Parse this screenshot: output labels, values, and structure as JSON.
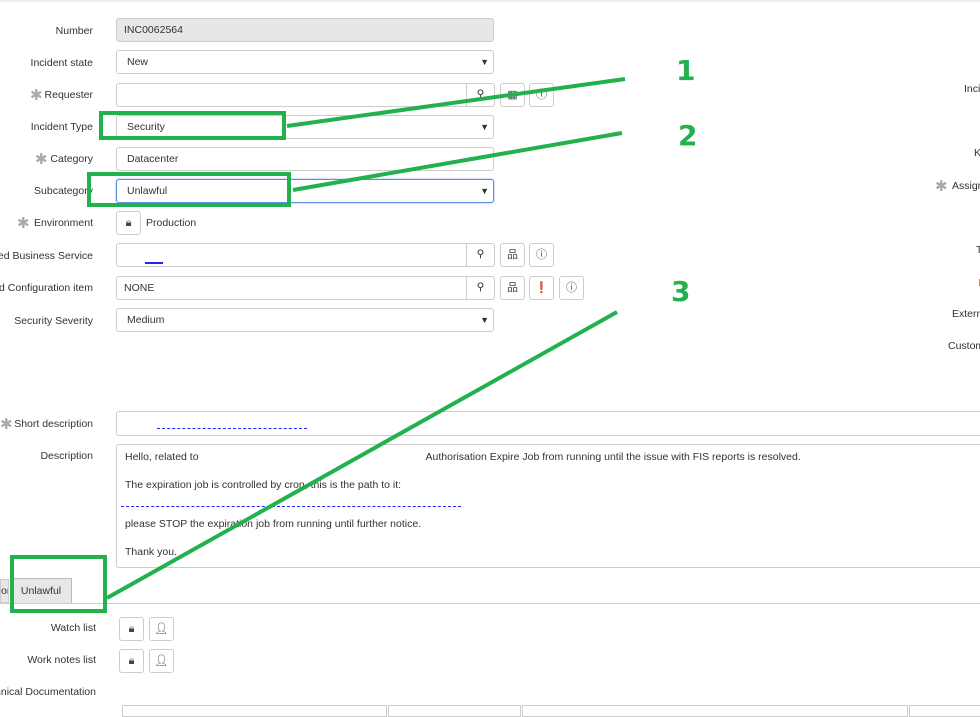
{
  "form": {
    "number": {
      "label": "Number",
      "value": "INC0062564"
    },
    "incident_state": {
      "label": "Incident state",
      "value": "New"
    },
    "requester": {
      "label": "Requester",
      "value": ""
    },
    "incident_type": {
      "label": "Incident Type",
      "value": "Security"
    },
    "category": {
      "label": "Category",
      "value": "Datacenter"
    },
    "subcategory": {
      "label": "Subcategory",
      "value": "Unlawful"
    },
    "environment": {
      "label": "Environment",
      "value": "Production"
    },
    "business_service": {
      "label": "cted Business Service",
      "value": ""
    },
    "config_item": {
      "label": "ed Configuration item",
      "value": "NONE"
    },
    "security_severity": {
      "label": "Security Severity",
      "value": "Medium"
    },
    "short_description": {
      "label": "Short description",
      "value": ""
    },
    "description": {
      "label": "Description",
      "lines": [
        "Hello, related to                                                                              Authorisation Expire Job from running until the issue with FIS reports is resolved.",
        "The expiration job is controlled by cron, this is the path to it:",
        "",
        "please STOP the expiration job from running until further notice.",
        "Thank you."
      ]
    }
  },
  "right_labels": [
    "Inci",
    "K",
    "Assign",
    "T",
    "I",
    "Externa",
    "Custom"
  ],
  "tabs": [
    "on",
    "Unlawful"
  ],
  "related": {
    "watch_list": "Watch list",
    "work_notes_list": "Work notes list",
    "tech_doc": "hnical Documentation"
  },
  "annotations": [
    "1",
    "2",
    "3"
  ],
  "colors": {
    "annotation": "#22b14c"
  }
}
